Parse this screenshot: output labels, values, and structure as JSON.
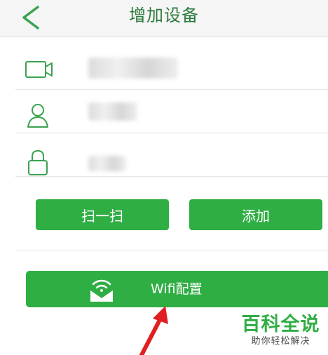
{
  "header": {
    "title": "增加设备",
    "back_icon": "chevron-left-icon"
  },
  "form": {
    "rows": [
      {
        "icon": "camera-icon"
      },
      {
        "icon": "user-icon"
      },
      {
        "icon": "lock-icon"
      }
    ]
  },
  "actions": {
    "scan_label": "扫一扫",
    "add_label": "添加"
  },
  "wifi": {
    "label": "Wifi配置",
    "icon": "wifi-envelope-icon"
  },
  "watermark": {
    "title": "百科全说",
    "subtitle": "助你轻松解决"
  },
  "colors": {
    "accent": "#2fae44",
    "icon_green": "#3aa24f",
    "arrow_red": "#e02020"
  }
}
